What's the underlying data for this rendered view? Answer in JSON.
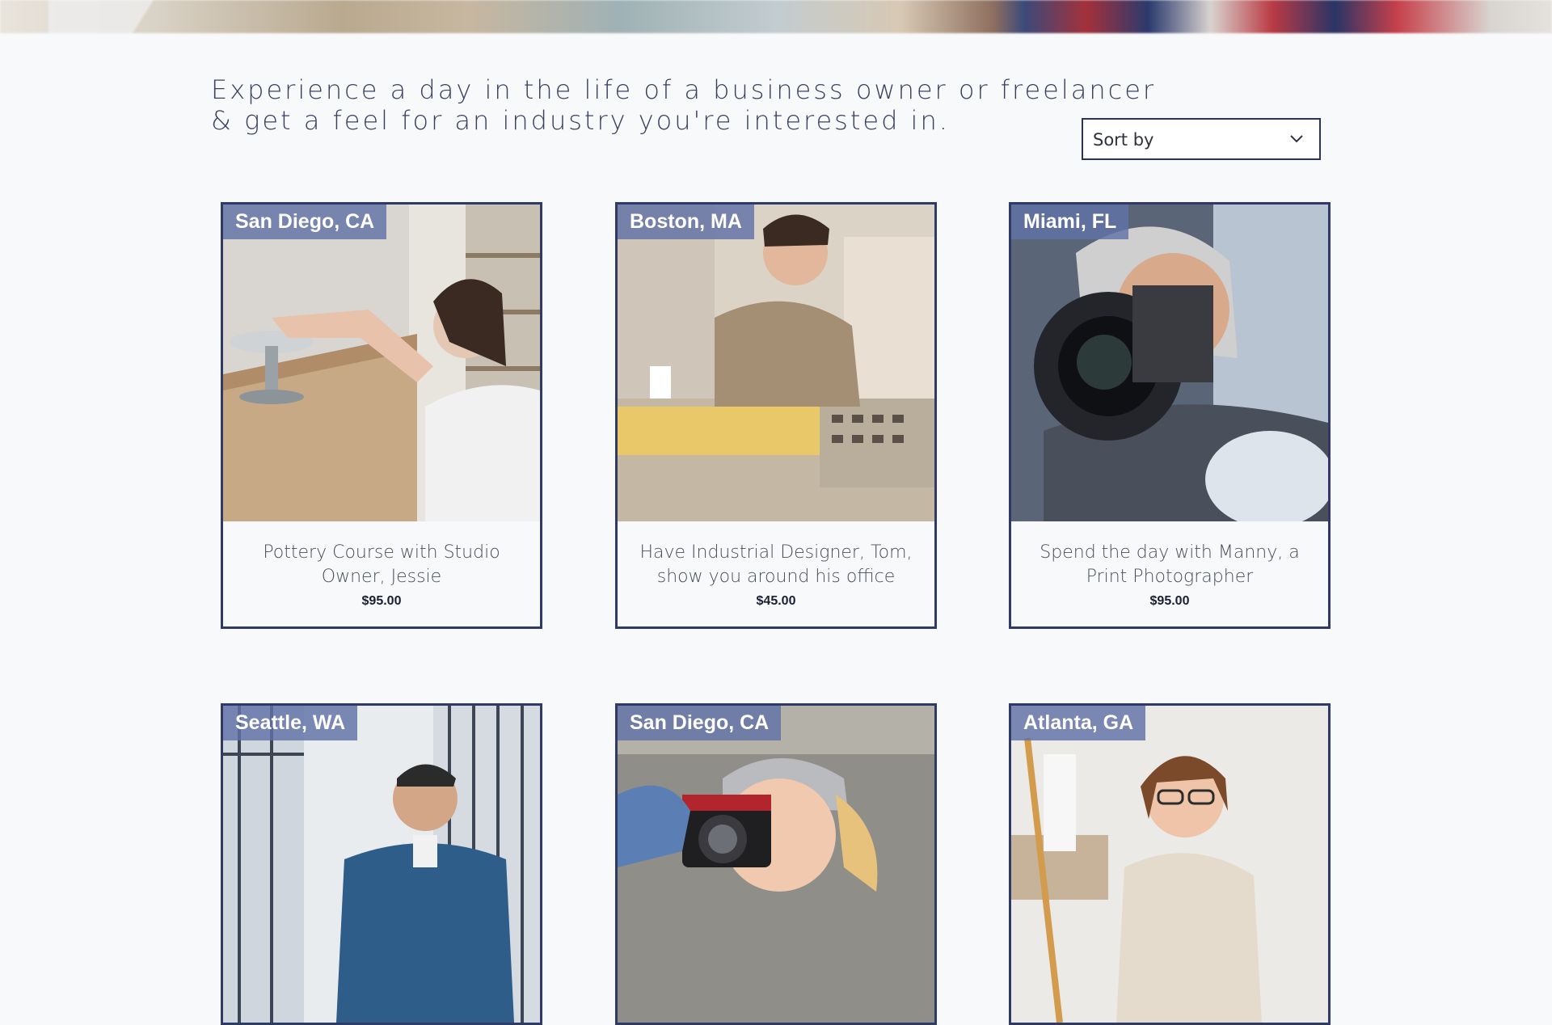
{
  "intro": {
    "line1": "Experience a day in the life of a business owner or freelancer",
    "line2": "& get a feel for an industry you're interested in."
  },
  "sort": {
    "label": "Sort by",
    "icon": "chevron-down-icon"
  },
  "products": [
    {
      "location": "San Diego, CA",
      "title": "Pottery Course with Studio Owner, Jessie",
      "price": "$95.00"
    },
    {
      "location": "Boston, MA",
      "title": "Have Industrial Designer, Tom, show you around his office",
      "price": "$45.00"
    },
    {
      "location": "Miami, FL",
      "title": "Spend the day with Manny, a Print Photographer",
      "price": "$95.00"
    },
    {
      "location": "Seattle, WA",
      "title": "",
      "price": ""
    },
    {
      "location": "San Diego, CA",
      "title": "",
      "price": ""
    },
    {
      "location": "Atlanta, GA",
      "title": "",
      "price": ""
    }
  ],
  "colors": {
    "card_border": "#2f3a66",
    "location_badge": "#6072a6",
    "text_dark": "#3a4160"
  }
}
